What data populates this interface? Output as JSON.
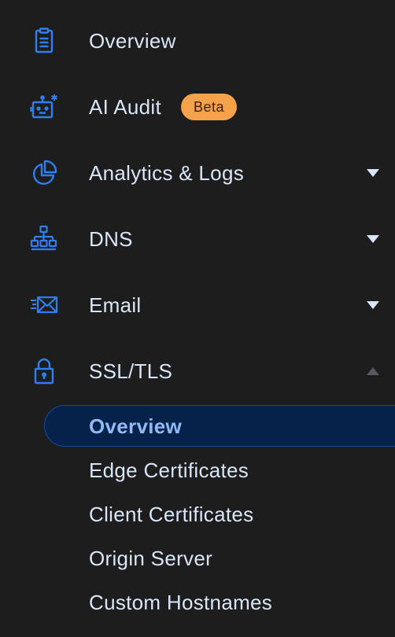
{
  "colors": {
    "background": "#1d1d1d",
    "icon_blue": "#2f7ff0",
    "text": "#d9e6f7",
    "badge_bg": "#f6a24a",
    "active_bg": "#06214a",
    "active_text": "#8fbaf6"
  },
  "nav": {
    "items": [
      {
        "label": "Overview",
        "icon": "clipboard-icon"
      },
      {
        "label": "AI Audit",
        "icon": "robot-icon",
        "badge": "Beta"
      },
      {
        "label": "Analytics & Logs",
        "icon": "pie-chart-icon",
        "expandable": true,
        "expanded": false
      },
      {
        "label": "DNS",
        "icon": "network-icon",
        "expandable": true,
        "expanded": false
      },
      {
        "label": "Email",
        "icon": "email-icon",
        "expandable": true,
        "expanded": false
      },
      {
        "label": "SSL/TLS",
        "icon": "lock-icon",
        "expandable": true,
        "expanded": true
      }
    ],
    "ssl_subitems": [
      {
        "label": "Overview",
        "active": true
      },
      {
        "label": "Edge Certificates",
        "active": false
      },
      {
        "label": "Client Certificates",
        "active": false
      },
      {
        "label": "Origin Server",
        "active": false
      },
      {
        "label": "Custom Hostnames",
        "active": false
      }
    ]
  }
}
